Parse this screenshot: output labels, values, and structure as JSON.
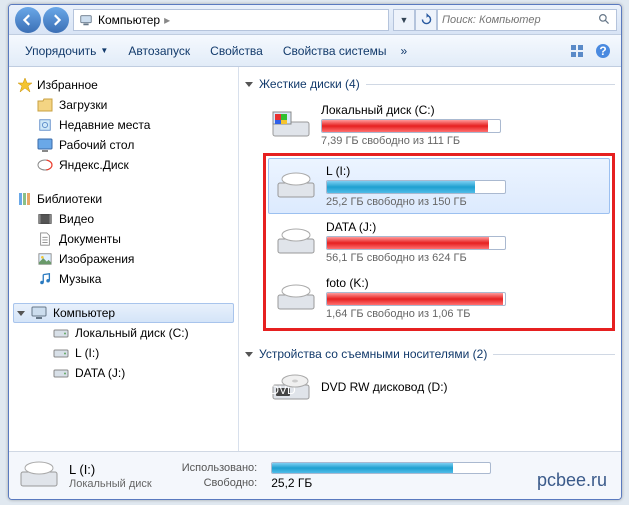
{
  "titlebar": {
    "breadcrumb_root": "Компьютер",
    "search_placeholder": "Поиск: Компьютер"
  },
  "toolbar": {
    "organize": "Упорядочить",
    "autoplay": "Автозапуск",
    "properties": "Свойства",
    "sys_properties": "Свойства системы"
  },
  "sidebar": {
    "favorites": {
      "label": "Избранное",
      "items": [
        "Загрузки",
        "Недавние места",
        "Рабочий стол",
        "Яндекс.Диск"
      ]
    },
    "libraries": {
      "label": "Библиотеки",
      "items": [
        "Видео",
        "Документы",
        "Изображения",
        "Музыка"
      ]
    },
    "computer": {
      "label": "Компьютер",
      "items": [
        "Локальный диск (C:)",
        "L (I:)",
        "DATA (J:)"
      ]
    }
  },
  "content": {
    "hdd_header": "Жесткие диски (4)",
    "removable_header": "Устройства со съемными носителями (2)",
    "drives": [
      {
        "name": "Локальный диск (C:)",
        "free": "7,39 ГБ свободно из 111 ГБ",
        "fill": 93,
        "color": "red"
      },
      {
        "name": "L (I:)",
        "free": "25,2 ГБ свободно из 150 ГБ",
        "fill": 83,
        "color": "blue"
      },
      {
        "name": "DATA (J:)",
        "free": "56,1 ГБ свободно из 624 ГБ",
        "fill": 91,
        "color": "red"
      },
      {
        "name": "foto (K:)",
        "free": "1,64 ГБ свободно из 1,06 ТБ",
        "fill": 99,
        "color": "red"
      }
    ],
    "optical": {
      "name": "DVD RW дисковод (D:)"
    }
  },
  "status": {
    "name": "L (I:)",
    "type": "Локальный диск",
    "used_label": "Использовано:",
    "free_label": "Свободно:",
    "free_val": "25,2 ГБ",
    "fill": 83
  },
  "watermark": "pcbee.ru"
}
